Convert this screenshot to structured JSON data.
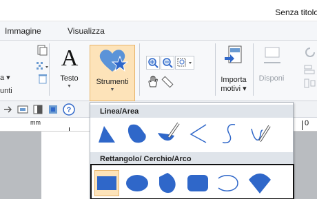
{
  "window": {
    "title": "Senza titolo"
  },
  "menus": [
    "Immagine",
    "Visualizza"
  ],
  "ribbon": {
    "group_label": "unti",
    "buttons": {
      "testo": "Testo",
      "strumenti": "Strumenti",
      "importa_line1": "Importa",
      "importa_line2": "motivi",
      "disponi": "Disponi"
    }
  },
  "ruler": {
    "unit": "mm"
  },
  "dropdown": {
    "section1": {
      "title": "Linea/Area",
      "shapes": [
        "polygon-area-icon",
        "freeform-area-icon",
        "brush-area-icon",
        "zigzag-line-icon",
        "curve-line-icon",
        "pen-line-icon"
      ]
    },
    "section2": {
      "title": "Rettangolo/ Cerchio/Arco",
      "shapes": [
        "rectangle-icon",
        "ellipse-icon",
        "pie-segment-icon",
        "rounded-rectangle-icon",
        "arc-icon",
        "fan-shape-icon"
      ]
    }
  },
  "colors": {
    "accent_fill": "#fde3b9",
    "accent_border": "#e7b46a",
    "shape_blue": "#2f67c9",
    "panel_bg": "#f7f8fa"
  }
}
